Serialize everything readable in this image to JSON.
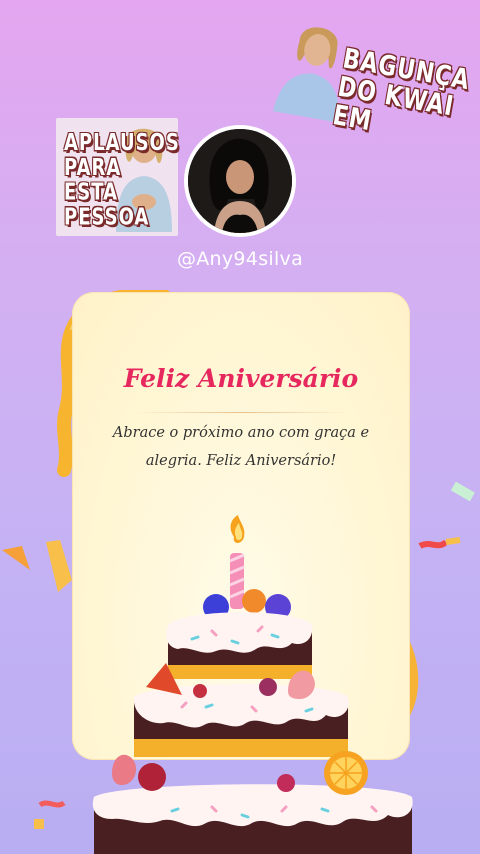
{
  "stickers": {
    "left_text": "APLAUSOS\nPARA ESTA\nPESSOA",
    "right_text": "BAGUNÇA\nDO KWAI EM"
  },
  "profile": {
    "username": "@Any94silva"
  },
  "card": {
    "title": "Feliz Aniversário",
    "message": "Abrace o próximo ano com graça e alegria. Feliz Aniversário!"
  },
  "colors": {
    "title": "#e6285f",
    "background_top": "#e4a6f0",
    "background_bottom": "#b9aef2"
  }
}
